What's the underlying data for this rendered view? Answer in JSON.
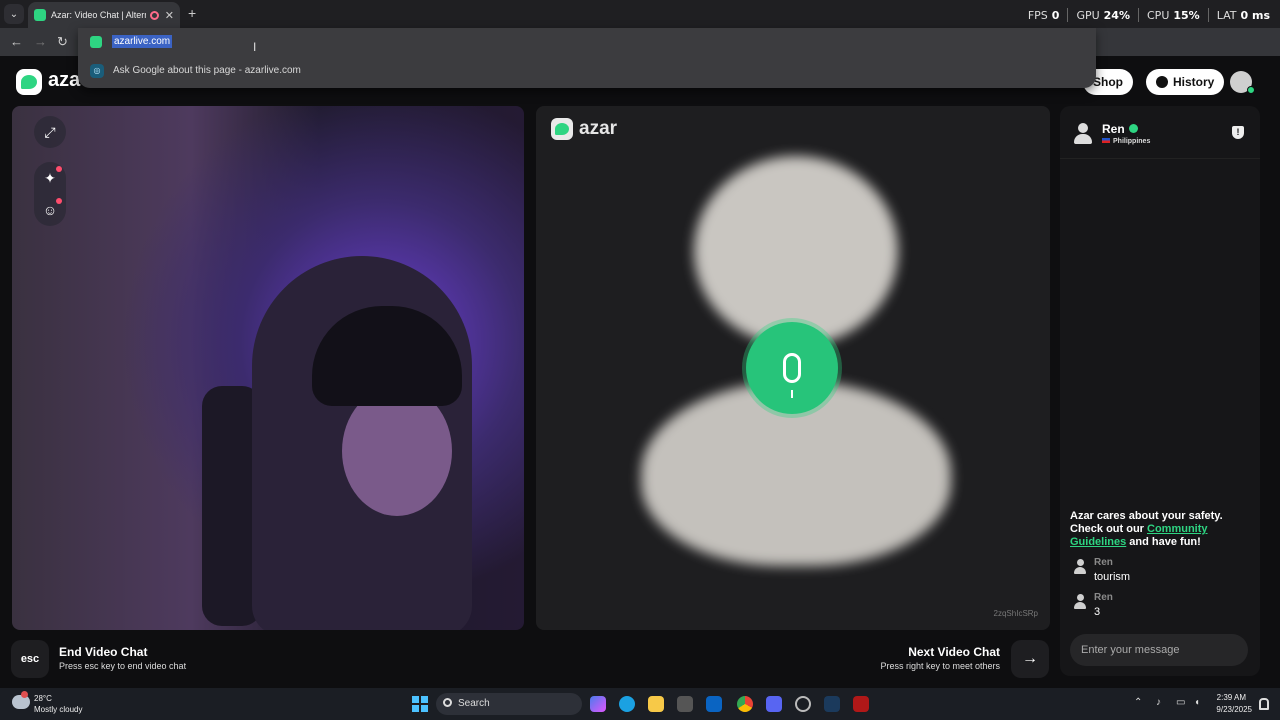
{
  "browser": {
    "tab_title": "Azar: Video Chat | Alternati",
    "new_tab_label": "+",
    "address": "azarlive.com",
    "suggestion": "Ask Google about this page - azarlive.com"
  },
  "perf": {
    "fps_label": "FPS",
    "fps_value": "0",
    "gpu_label": "GPU",
    "gpu_value": "24%",
    "cpu_label": "CPU",
    "cpu_value": "15%",
    "lat_label": "LAT",
    "lat_value": "0 ms"
  },
  "app": {
    "logo_text": "aza",
    "shop_label": "Shop",
    "history_label": "History",
    "remote_logo_text": "azar",
    "session_id": "2zqShIcSRp",
    "accent": "#2ed582"
  },
  "peer": {
    "name": "Ren",
    "country": "Philippines"
  },
  "chat": {
    "safety_pre": "Azar cares about your safety. Check out our ",
    "safety_link": "Community Guidelines",
    "safety_post": " and have fun!",
    "messages": [
      {
        "author": "Ren",
        "text": "tourism"
      },
      {
        "author": "Ren",
        "text": "3"
      }
    ],
    "input_placeholder": "Enter your message"
  },
  "controls": {
    "esc_key": "esc",
    "end_title": "End Video Chat",
    "end_sub": "Press esc key to end video chat",
    "next_title": "Next Video Chat",
    "next_sub": "Press right key to meet others",
    "next_icon": "→"
  },
  "taskbar": {
    "temp": "28°C",
    "condition": "Mostly cloudy",
    "search_label": "Search",
    "time": "2:39 AM",
    "date": "9/23/2025"
  },
  "icons": [
    "back-icon",
    "forward-icon",
    "reload-icon",
    "fullscreen-icon",
    "sparkle-icon",
    "face-icon",
    "mic-icon",
    "report-icon",
    "arrow-right-icon"
  ]
}
